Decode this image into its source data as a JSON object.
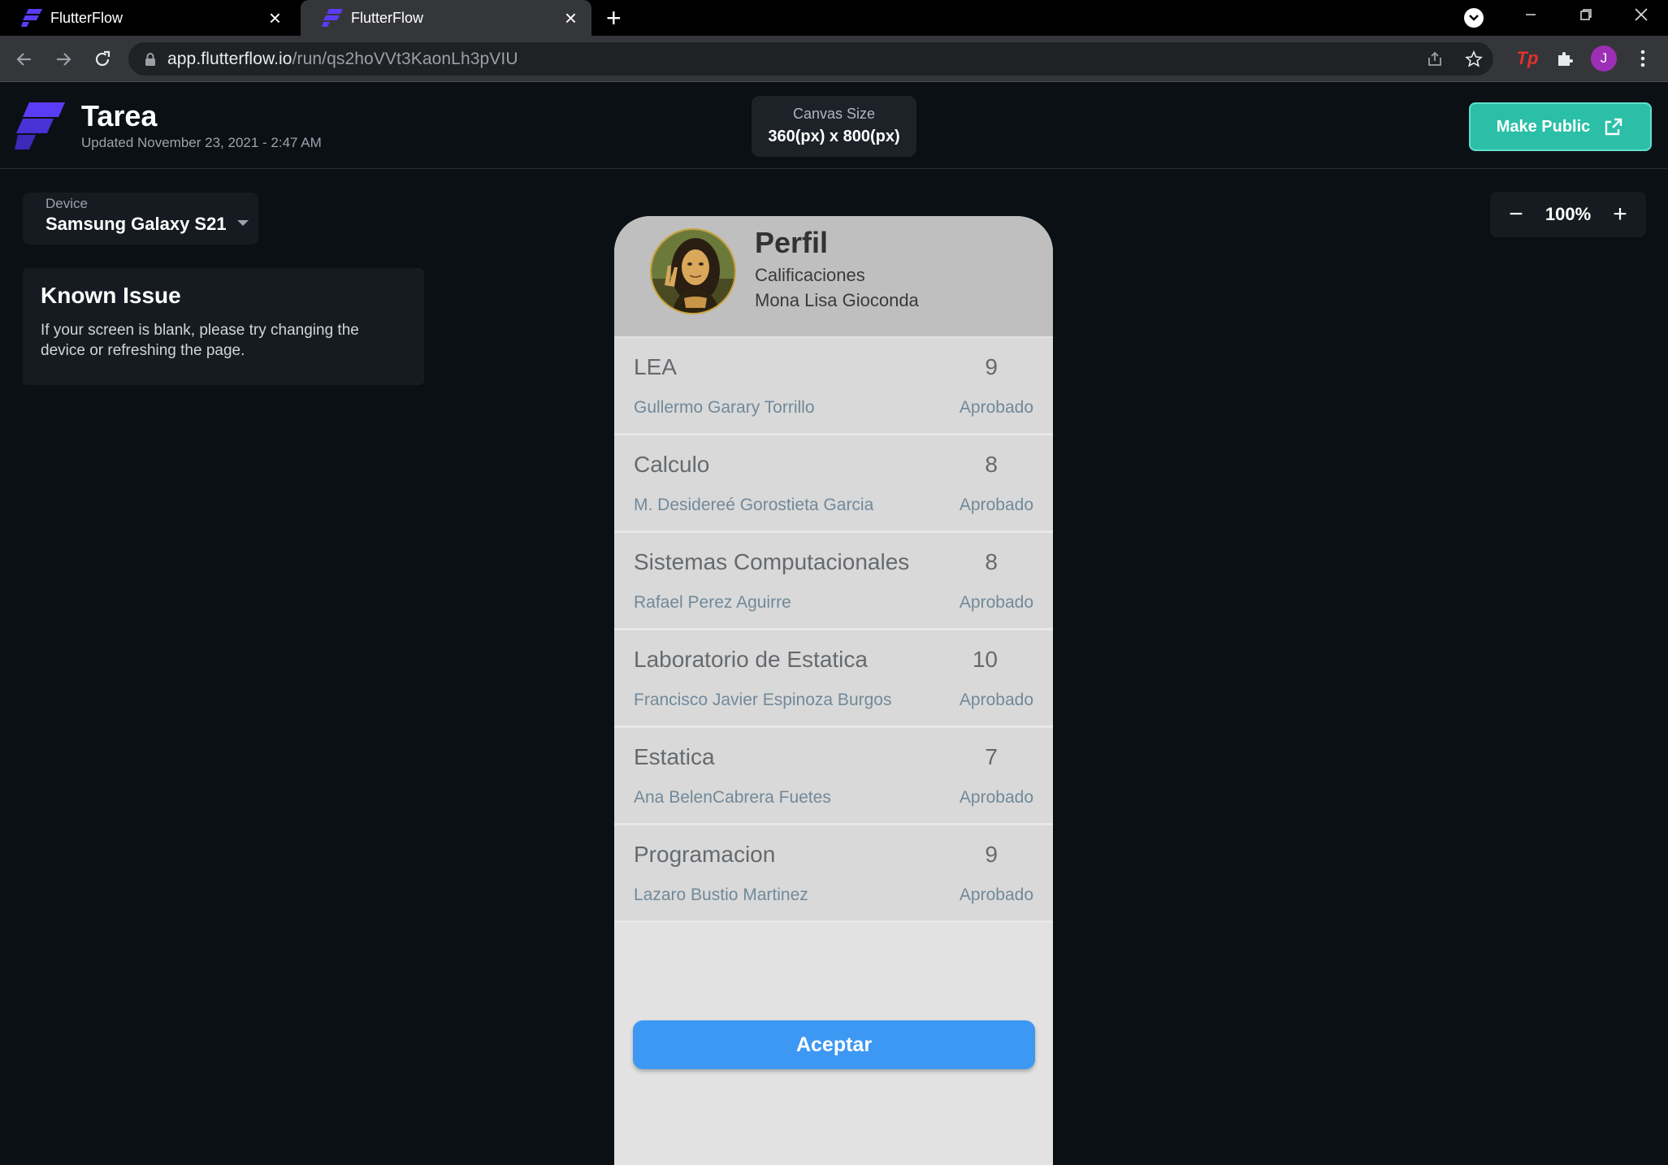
{
  "browser": {
    "tabs": [
      {
        "title": "FlutterFlow"
      },
      {
        "title": "FlutterFlow"
      }
    ],
    "url_host": "app.flutterflow.io",
    "url_path": "/run/qs2hoVVt3KaonLh3pVIU",
    "profile_initial": "J",
    "extension_tp": "Tp"
  },
  "header": {
    "project_title": "Tarea",
    "updated": "Updated  November 23, 2021 - 2:47 AM",
    "canvas_label": "Canvas Size",
    "canvas_value": "360(px) x 800(px)",
    "make_public": "Make Public"
  },
  "device": {
    "label": "Device",
    "value": "Samsung Galaxy S21"
  },
  "known_issue": {
    "title": "Known Issue",
    "text": "If your screen is blank, please try changing the device or refreshing the page."
  },
  "zoom": {
    "minus": "−",
    "value": "100%",
    "plus": "+"
  },
  "app": {
    "title": "Perfil",
    "subtitle": "Calificaciones",
    "student": "Mona Lisa Gioconda",
    "courses": [
      {
        "name": "LEA",
        "grade": "9",
        "teacher": "Gullermo Garary Torrillo",
        "status": "Aprobado"
      },
      {
        "name": "Calculo",
        "grade": "8",
        "teacher": "M. Desidereé Gorostieta Garcia",
        "status": "Aprobado"
      },
      {
        "name": "Sistemas Computacionales",
        "grade": "8",
        "teacher": "Rafael Perez  Aguirre",
        "status": "Aprobado"
      },
      {
        "name": "Laboratorio de Estatica",
        "grade": "10",
        "teacher": "Francisco Javier Espinoza Burgos",
        "status": "Aprobado"
      },
      {
        "name": "Estatica",
        "grade": "7",
        "teacher": "Ana BelenCabrera Fuetes",
        "status": "Aprobado"
      },
      {
        "name": "Programacion",
        "grade": "9",
        "teacher": "Lazaro Bustio Martinez",
        "status": "Aprobado"
      }
    ],
    "accept_button": "Aceptar"
  },
  "colors": {
    "accent_teal": "#2bbfa8",
    "accept_blue": "#3d98f3",
    "flutterflow_purple": "#5b3cf5"
  }
}
